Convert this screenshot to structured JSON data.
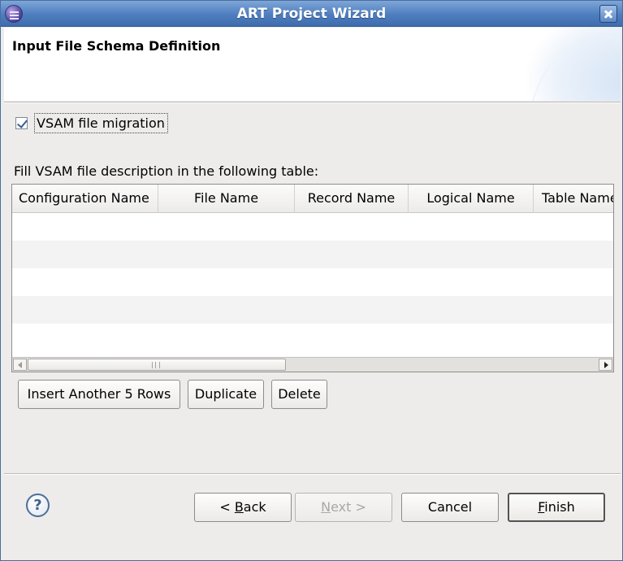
{
  "window": {
    "title": "ART Project Wizard"
  },
  "header": {
    "title": "Input File Schema Definition"
  },
  "vsam_checkbox": {
    "label": "VSAM file migration",
    "checked": true
  },
  "description": "Fill VSAM file description in the following table:",
  "table": {
    "columns": [
      "Configuration Name",
      "File Name",
      "Record Name",
      "Logical Name",
      "Table Name"
    ],
    "rows": [
      [],
      [],
      [],
      [],
      []
    ]
  },
  "table_buttons": {
    "insert": "Insert Another 5 Rows",
    "duplicate": "Duplicate",
    "delete": "Delete"
  },
  "footer": {
    "help_icon": "?",
    "back": {
      "prefix": "< ",
      "mnemonic": "B",
      "rest": "ack"
    },
    "next": {
      "mnemonic": "N",
      "rest": "ext >",
      "enabled": false
    },
    "cancel": "Cancel",
    "finish": {
      "mnemonic": "F",
      "rest": "inish"
    }
  },
  "icons": {
    "app": "eclipse-app-icon",
    "close": "close-icon",
    "help": "help-icon",
    "scroll_left": "arrow-left-icon",
    "scroll_right": "arrow-right-icon"
  },
  "colors": {
    "titlebar": "#4f7ebf",
    "dialog_bg": "#edeceb",
    "disabled_text": "#aaa8a4"
  }
}
